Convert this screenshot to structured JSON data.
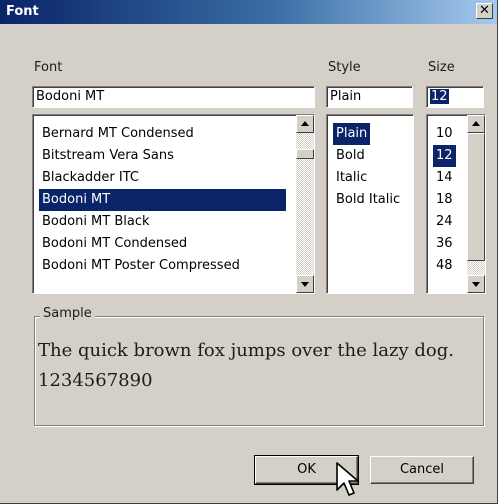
{
  "window": {
    "title": "Font",
    "close_glyph": "✕"
  },
  "labels": {
    "font": "Font",
    "style": "Style",
    "size": "Size"
  },
  "font_field": {
    "value": "Bodoni MT"
  },
  "style_field": {
    "value": "Plain"
  },
  "size_field": {
    "value": "12"
  },
  "font_list": {
    "items": [
      {
        "label": "Bernard MT Condensed"
      },
      {
        "label": "Bitstream Vera Sans"
      },
      {
        "label": "Blackadder ITC"
      },
      {
        "label": "Bodoni MT"
      },
      {
        "label": "Bodoni MT Black"
      },
      {
        "label": "Bodoni MT Condensed"
      },
      {
        "label": "Bodoni MT Poster Compressed"
      }
    ],
    "selected": "Bodoni MT"
  },
  "style_list": {
    "items": [
      {
        "label": "Plain"
      },
      {
        "label": "Bold"
      },
      {
        "label": "Italic"
      },
      {
        "label": "Bold Italic"
      }
    ],
    "selected": "Plain"
  },
  "size_list": {
    "items": [
      {
        "label": "10"
      },
      {
        "label": "12"
      },
      {
        "label": "14"
      },
      {
        "label": "18"
      },
      {
        "label": "24"
      },
      {
        "label": "36"
      },
      {
        "label": "48"
      }
    ],
    "selected": "12"
  },
  "sample": {
    "label": "Sample",
    "text": "The quick brown fox jumps over the lazy dog.  1234567890"
  },
  "buttons": {
    "ok": "OK",
    "cancel": "Cancel"
  },
  "icons": {
    "close": "close-icon",
    "scroll_up": "scroll-up-arrow-icon",
    "scroll_down": "scroll-down-arrow-icon",
    "cursor": "mouse-pointer-icon"
  },
  "colors": {
    "titlebar_start": "#0a246a",
    "titlebar_end": "#a6caf0",
    "selection": "#0a246a",
    "dialog_bg": "#d4d0c8"
  }
}
